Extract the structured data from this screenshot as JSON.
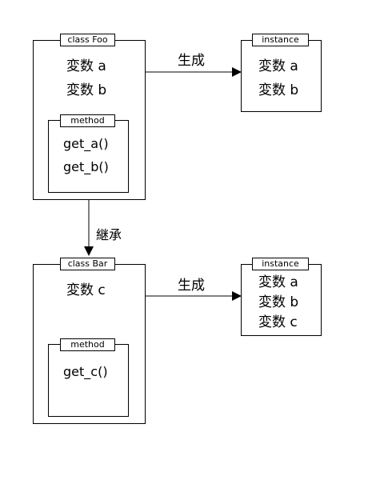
{
  "foo": {
    "title": "class Foo",
    "vars": [
      "変数 a",
      "変数 b"
    ],
    "method_title": "method",
    "methods": [
      "get_a()",
      "get_b()"
    ]
  },
  "foo_instance": {
    "title": "instance",
    "vars": [
      "変数 a",
      "変数 b"
    ]
  },
  "bar": {
    "title": "class Bar",
    "vars": [
      "変数 c"
    ],
    "method_title": "method",
    "methods": [
      "get_c()"
    ]
  },
  "bar_instance": {
    "title": "instance",
    "vars": [
      "変数 a",
      "変数 b",
      "変数 c"
    ]
  },
  "labels": {
    "create_top": "生成",
    "create_bottom": "生成",
    "inherit": "継承"
  }
}
